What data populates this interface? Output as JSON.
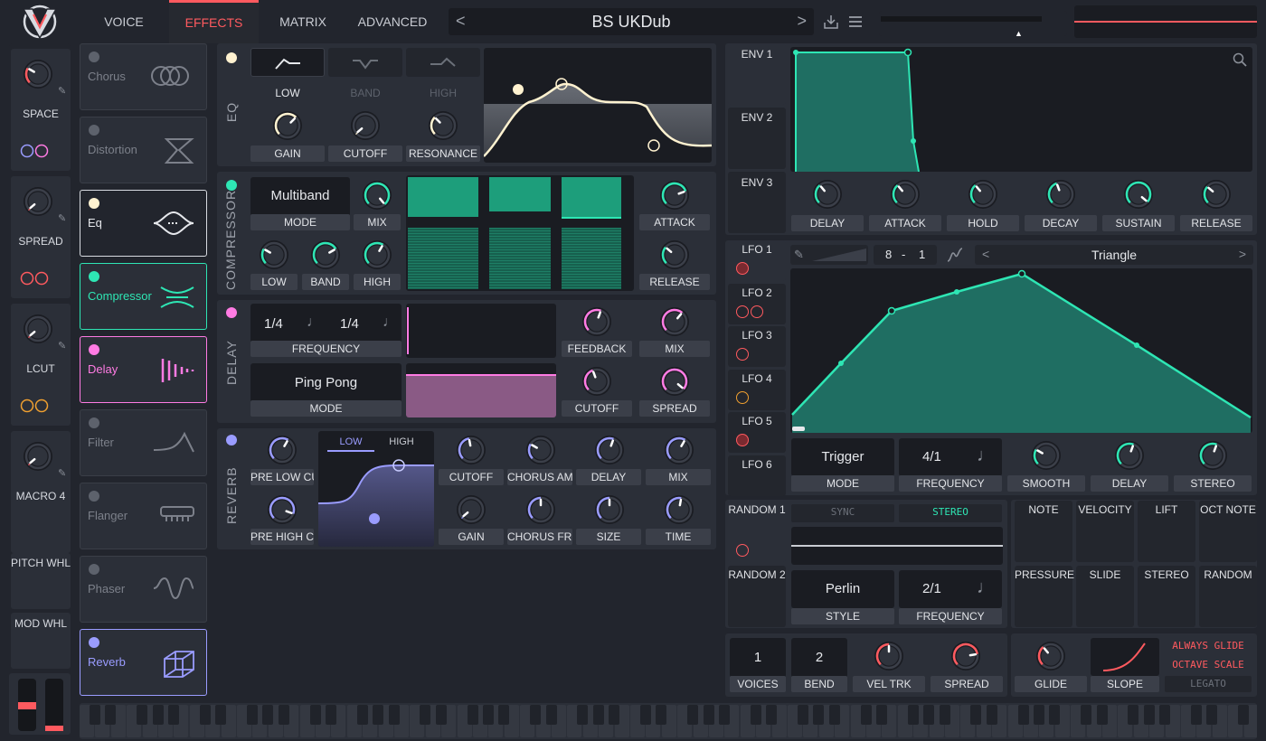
{
  "tabs": [
    "VOICE",
    "EFFECTS",
    "MATRIX",
    "ADVANCED"
  ],
  "preset": {
    "name": "BS UKDub",
    "prev": "<",
    "next": ">"
  },
  "macros": [
    {
      "label": "SPACE"
    },
    {
      "label": "SPREAD"
    },
    {
      "label": "LCUT"
    },
    {
      "label": "MACRO 4"
    }
  ],
  "wheels": {
    "pitch": "PITCH WHL",
    "mod": "MOD WHL"
  },
  "fx_list": [
    {
      "name": "Chorus",
      "active": false
    },
    {
      "name": "Distortion",
      "active": false
    },
    {
      "name": "Eq",
      "active": true,
      "color": "#fff2d0"
    },
    {
      "name": "Compressor",
      "active": true,
      "color": "#2ee6b4"
    },
    {
      "name": "Delay",
      "active": true,
      "color": "#ff7be3"
    },
    {
      "name": "Filter",
      "active": false
    },
    {
      "name": "Flanger",
      "active": false
    },
    {
      "name": "Phaser",
      "active": false
    },
    {
      "name": "Reverb",
      "active": true,
      "color": "#9a9cff"
    }
  ],
  "eq": {
    "title": "EQ",
    "bands": [
      "LOW",
      "BAND",
      "HIGH"
    ],
    "knobs": [
      "GAIN",
      "CUTOFF",
      "RESONANCE"
    ]
  },
  "compressor": {
    "title": "COMPRESSOR",
    "mode_value": "Multiband",
    "mode": "MODE",
    "mix": "MIX",
    "bands": [
      "LOW",
      "BAND",
      "HIGH"
    ],
    "attack": "ATTACK",
    "release": "RELEASE"
  },
  "delay": {
    "title": "DELAY",
    "freq_left": "1/4",
    "freq_right": "1/4",
    "frequency": "FREQUENCY",
    "feedback": "FEEDBACK",
    "mix": "MIX",
    "mode_value": "Ping Pong",
    "mode": "MODE",
    "cutoff": "CUTOFF",
    "spread": "SPREAD"
  },
  "reverb": {
    "title": "REVERB",
    "pre_low": "PRE LOW CUT",
    "pre_high": "PRE HIGH CUT",
    "tab_low": "LOW",
    "tab_high": "HIGH",
    "row1": [
      "CUTOFF",
      "CHORUS AMT",
      "DELAY",
      "MIX"
    ],
    "row2": [
      "GAIN",
      "CHORUS FRQ",
      "SIZE",
      "TIME"
    ]
  },
  "envelopes": {
    "items": [
      "ENV 1",
      "ENV 2",
      "ENV 3"
    ],
    "knobs": [
      "DELAY",
      "ATTACK",
      "HOLD",
      "DECAY",
      "SUSTAIN",
      "RELEASE"
    ]
  },
  "lfos": {
    "items": [
      "LFO 1",
      "LFO 2",
      "LFO 3",
      "LFO 4",
      "LFO 5",
      "LFO 6"
    ],
    "rate_num": "8",
    "rate_sep": "-",
    "rate_den": "1",
    "shape": "Triangle",
    "mode_value": "Trigger",
    "mode": "MODE",
    "freq_value": "4/1",
    "frequency": "FREQUENCY",
    "smooth": "SMOOTH",
    "delay": "DELAY",
    "stereo": "STEREO"
  },
  "random": {
    "items": [
      "RANDOM 1",
      "RANDOM 2"
    ],
    "sync": "SYNC",
    "stereo": "STEREO",
    "style_value": "Perlin",
    "style": "STYLE",
    "freq_value": "2/1",
    "frequency": "FREQUENCY"
  },
  "mod_sources": {
    "row1": [
      "NOTE",
      "VELOCITY",
      "LIFT",
      "OCT NOTE"
    ],
    "row2": [
      "PRESSURE",
      "SLIDE",
      "STEREO",
      "RANDOM"
    ]
  },
  "voice": {
    "voices_value": "1",
    "voices": "VOICES",
    "bend_value": "2",
    "bend": "BEND",
    "vel_trk": "VEL TRK",
    "spread": "SPREAD",
    "glide": "GLIDE",
    "slope": "SLOPE",
    "always_glide": "ALWAYS GLIDE",
    "octave_scale": "OCTAVE SCALE",
    "legato": "LEGATO"
  },
  "colors": {
    "accent": "#ff5a5f",
    "teal": "#2ee6b4",
    "pink": "#ff7be3",
    "violet": "#9a9cff",
    "cream": "#fff2d0"
  }
}
